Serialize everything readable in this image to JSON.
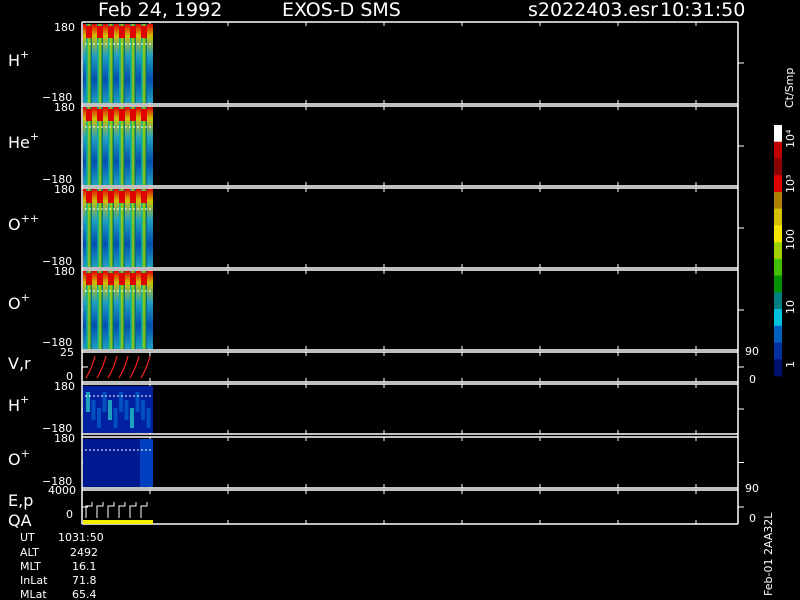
{
  "header": {
    "date": "Feb 24, 1992",
    "mission": "EXOS-D SMS",
    "file": "s2022403.esr",
    "time": "10:31:50"
  },
  "colorbar": {
    "unit": "Ct/Smp",
    "ticks": [
      "10⁴",
      "10³",
      "100",
      "10",
      "1"
    ],
    "colors": [
      "#ffffff",
      "#c00000",
      "#8a0000",
      "#e00000",
      "#b08000",
      "#d6c000",
      "#f5e800",
      "#a0d000",
      "#40c000",
      "#009000",
      "#008080",
      "#00c0e0",
      "#0060c0",
      "#0030a0",
      "#001070"
    ]
  },
  "panels": [
    {
      "label": "H",
      "sup": "+",
      "top": "180",
      "bottom": "−180",
      "right": ""
    },
    {
      "label": "He",
      "sup": "+",
      "top": "180",
      "bottom": "−180",
      "right": ""
    },
    {
      "label": "O",
      "sup": "++",
      "top": "180",
      "bottom": "−180",
      "right": ""
    },
    {
      "label": "O",
      "sup": "+",
      "top": "180",
      "bottom": "−180",
      "right": ""
    },
    {
      "label": "V,r",
      "sup": "",
      "top": "25",
      "bottom": "0",
      "right_top": "90",
      "right_bottom": "0"
    },
    {
      "label": "H",
      "sup": "+",
      "top": "180",
      "bottom": "−180",
      "right": ""
    },
    {
      "label": "O",
      "sup": "+",
      "top": "180",
      "bottom": "−180",
      "right": ""
    },
    {
      "label": "E,p",
      "label2": "QA",
      "sup": "",
      "top": "4000",
      "bottom": "0",
      "right_top": "90",
      "right_bottom": "0"
    }
  ],
  "stats": [
    {
      "name": "UT",
      "value": "1031:50"
    },
    {
      "name": "ALT",
      "value": "2492"
    },
    {
      "name": "MLT",
      "value": "16.1"
    },
    {
      "name": "InLat",
      "value": "71.8"
    },
    {
      "name": "MLat",
      "value": "65.4"
    }
  ],
  "footer_vertical": "Feb-01 2AA32L",
  "chart_data": {
    "type": "heatmap",
    "title": "Feb 24, 1992   EXOS-D SMS",
    "panels": [
      "H+",
      "He+",
      "O++",
      "O+",
      "V,r",
      "H+",
      "O+",
      "E,p QA"
    ],
    "ylim_angle": [
      -180,
      180
    ],
    "colorbar_scale": "log",
    "colorbar_range": [
      1,
      10000
    ]
  }
}
